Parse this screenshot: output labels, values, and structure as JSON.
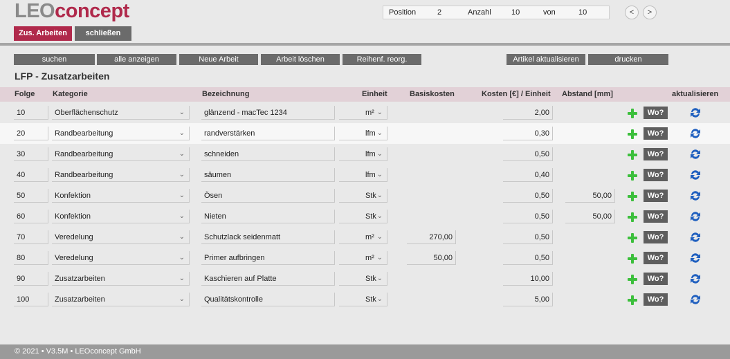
{
  "logo": {
    "part1": "LEO",
    "part2": "concept"
  },
  "nav": {
    "position_label": "Position",
    "position_value": "2",
    "count_label": "Anzahl",
    "count_value": "10",
    "of_label": "von",
    "of_value": "10",
    "prev_label": "<",
    "next_label": ">"
  },
  "top_buttons": {
    "extra_work": "Zus. Arbeiten",
    "close": "schließen"
  },
  "colors": {
    "brand": "#b0294b",
    "button_grey": "#6b6b6b",
    "header_band": "#e2d1d7",
    "plus_green": "#3cbf3c",
    "refresh_blue": "#1f5fbf"
  },
  "actions": {
    "search": "suchen",
    "show_all": "alle anzeigen",
    "new": "Neue Arbeit",
    "delete": "Arbeit löschen",
    "reorder": "Reihenf. reorg.",
    "update_articles": "Artikel aktualisieren",
    "print": "drucken"
  },
  "page_title": "LFP - Zusatzarbeiten",
  "columns": {
    "folge": "Folge",
    "kategorie": "Kategorie",
    "bezeichnung": "Bezeichnung",
    "einheit": "Einheit",
    "basiskosten": "Basiskosten",
    "kosten": "Kosten [€] / Einheit",
    "abstand": "Abstand [mm]",
    "aktualisieren": "aktualisieren"
  },
  "rows": [
    {
      "folge": "10",
      "kategorie": "Oberflächenschutz",
      "bezeichnung": "glänzend - macTec 1234",
      "einheit": "m²",
      "basiskosten": "",
      "kosten": "2,00",
      "abstand": "",
      "wo": "Wo?"
    },
    {
      "folge": "20",
      "kategorie": "Randbearbeitung",
      "bezeichnung": "randverstärken",
      "einheit": "lfm",
      "basiskosten": "",
      "kosten": "0,30",
      "abstand": "",
      "wo": "Wo?"
    },
    {
      "folge": "30",
      "kategorie": "Randbearbeitung",
      "bezeichnung": "schneiden",
      "einheit": "lfm",
      "basiskosten": "",
      "kosten": "0,50",
      "abstand": "",
      "wo": "Wo?"
    },
    {
      "folge": "40",
      "kategorie": "Randbearbeitung",
      "bezeichnung": "säumen",
      "einheit": "lfm",
      "basiskosten": "",
      "kosten": "0,40",
      "abstand": "",
      "wo": "Wo?"
    },
    {
      "folge": "50",
      "kategorie": "Konfektion",
      "bezeichnung": "Ösen",
      "einheit": "Stk",
      "basiskosten": "",
      "kosten": "0,50",
      "abstand": "50,00",
      "wo": "Wo?"
    },
    {
      "folge": "60",
      "kategorie": "Konfektion",
      "bezeichnung": "Nieten",
      "einheit": "Stk",
      "basiskosten": "",
      "kosten": "0,50",
      "abstand": "50,00",
      "wo": "Wo?"
    },
    {
      "folge": "70",
      "kategorie": "Veredelung",
      "bezeichnung": "Schutzlack seidenmatt",
      "einheit": "m²",
      "basiskosten": "270,00",
      "kosten": "0,50",
      "abstand": "",
      "wo": "Wo?"
    },
    {
      "folge": "80",
      "kategorie": "Veredelung",
      "bezeichnung": "Primer aufbringen",
      "einheit": "m²",
      "basiskosten": "50,00",
      "kosten": "0,50",
      "abstand": "",
      "wo": "Wo?"
    },
    {
      "folge": "90",
      "kategorie": "Zusatzarbeiten",
      "bezeichnung": "Kaschieren auf Platte",
      "einheit": "Stk",
      "basiskosten": "",
      "kosten": "10,00",
      "abstand": "",
      "wo": "Wo?"
    },
    {
      "folge": "100",
      "kategorie": "Zusatzarbeiten",
      "bezeichnung": "Qualitätskontrolle",
      "einheit": "Stk",
      "basiskosten": "",
      "kosten": "5,00",
      "abstand": "",
      "wo": "Wo?"
    }
  ],
  "footer": "© 2021 • V3.5M • LEOconcept GmbH"
}
